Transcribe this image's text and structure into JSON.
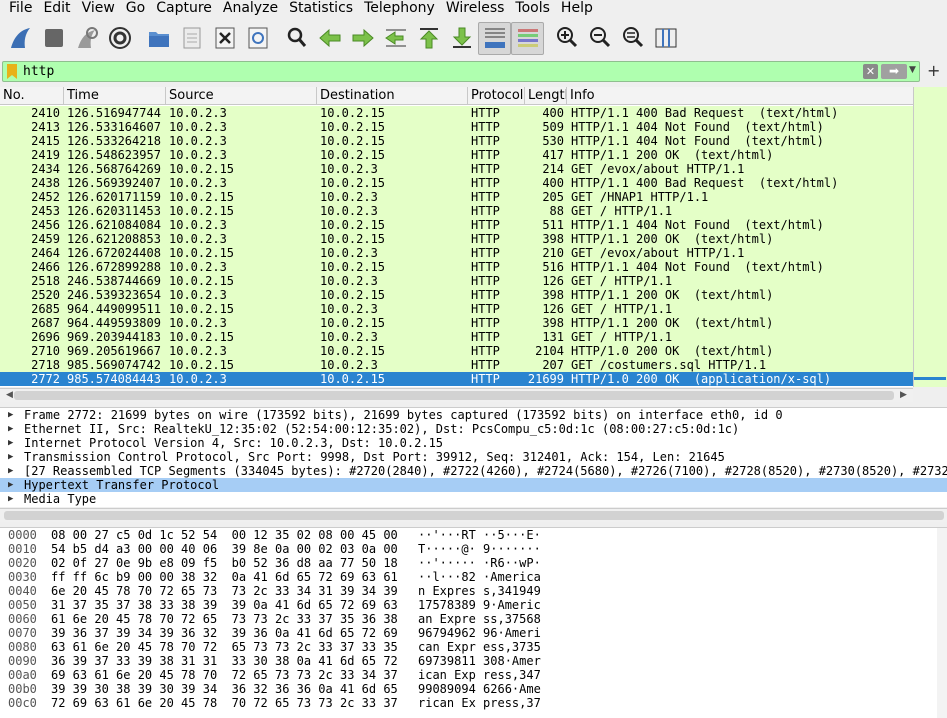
{
  "menu": [
    "File",
    "Edit",
    "View",
    "Go",
    "Capture",
    "Analyze",
    "Statistics",
    "Telephony",
    "Wireless",
    "Tools",
    "Help"
  ],
  "toolbar": {
    "icons": [
      "shark-fin-start-icon",
      "stop-capture-icon",
      "restart-capture-icon",
      "capture-options-icon",
      "open-file-icon",
      "save-file-icon",
      "close-file-icon",
      "reload-file-icon",
      "find-packet-icon",
      "go-back-icon",
      "go-forward-icon",
      "go-to-packet-icon",
      "go-first-icon",
      "go-last-icon",
      "autoscroll-icon",
      "colorize-icon",
      "zoom-in-icon",
      "zoom-out-icon",
      "zoom-reset-icon",
      "resize-columns-icon"
    ]
  },
  "filter": {
    "value": "http",
    "plus": "+"
  },
  "columns": {
    "no": "No.",
    "time": "Time",
    "source": "Source",
    "destination": "Destination",
    "protocol": "Protocol",
    "length": "Length",
    "info": "Info"
  },
  "packets": [
    {
      "no": "2410",
      "time": "126.516947744",
      "src": "10.0.2.3",
      "dst": "10.0.2.15",
      "proto": "HTTP",
      "len": "400",
      "info": "HTTP/1.1 400 Bad Request  (text/html)"
    },
    {
      "no": "2413",
      "time": "126.533164607",
      "src": "10.0.2.3",
      "dst": "10.0.2.15",
      "proto": "HTTP",
      "len": "509",
      "info": "HTTP/1.1 404 Not Found  (text/html)"
    },
    {
      "no": "2415",
      "time": "126.533264218",
      "src": "10.0.2.3",
      "dst": "10.0.2.15",
      "proto": "HTTP",
      "len": "530",
      "info": "HTTP/1.1 404 Not Found  (text/html)"
    },
    {
      "no": "2419",
      "time": "126.548623957",
      "src": "10.0.2.3",
      "dst": "10.0.2.15",
      "proto": "HTTP",
      "len": "417",
      "info": "HTTP/1.1 200 OK  (text/html)"
    },
    {
      "no": "2434",
      "time": "126.568764269",
      "src": "10.0.2.15",
      "dst": "10.0.2.3",
      "proto": "HTTP",
      "len": "214",
      "info": "GET /evox/about HTTP/1.1"
    },
    {
      "no": "2438",
      "time": "126.569392407",
      "src": "10.0.2.3",
      "dst": "10.0.2.15",
      "proto": "HTTP",
      "len": "400",
      "info": "HTTP/1.1 400 Bad Request  (text/html)"
    },
    {
      "no": "2452",
      "time": "126.620171159",
      "src": "10.0.2.15",
      "dst": "10.0.2.3",
      "proto": "HTTP",
      "len": "205",
      "info": "GET /HNAP1 HTTP/1.1"
    },
    {
      "no": "2453",
      "time": "126.620311453",
      "src": "10.0.2.15",
      "dst": "10.0.2.3",
      "proto": "HTTP",
      "len": "88",
      "info": "GET / HTTP/1.1"
    },
    {
      "no": "2456",
      "time": "126.621084084",
      "src": "10.0.2.3",
      "dst": "10.0.2.15",
      "proto": "HTTP",
      "len": "511",
      "info": "HTTP/1.1 404 Not Found  (text/html)"
    },
    {
      "no": "2459",
      "time": "126.621208853",
      "src": "10.0.2.3",
      "dst": "10.0.2.15",
      "proto": "HTTP",
      "len": "398",
      "info": "HTTP/1.1 200 OK  (text/html)"
    },
    {
      "no": "2464",
      "time": "126.672024408",
      "src": "10.0.2.15",
      "dst": "10.0.2.3",
      "proto": "HTTP",
      "len": "210",
      "info": "GET /evox/about HTTP/1.1"
    },
    {
      "no": "2466",
      "time": "126.672899288",
      "src": "10.0.2.3",
      "dst": "10.0.2.15",
      "proto": "HTTP",
      "len": "516",
      "info": "HTTP/1.1 404 Not Found  (text/html)"
    },
    {
      "no": "2518",
      "time": "246.538744669",
      "src": "10.0.2.15",
      "dst": "10.0.2.3",
      "proto": "HTTP",
      "len": "126",
      "info": "GET / HTTP/1.1"
    },
    {
      "no": "2520",
      "time": "246.539323654",
      "src": "10.0.2.3",
      "dst": "10.0.2.15",
      "proto": "HTTP",
      "len": "398",
      "info": "HTTP/1.1 200 OK  (text/html)"
    },
    {
      "no": "2685",
      "time": "964.449099511",
      "src": "10.0.2.15",
      "dst": "10.0.2.3",
      "proto": "HTTP",
      "len": "126",
      "info": "GET / HTTP/1.1"
    },
    {
      "no": "2687",
      "time": "964.449593809",
      "src": "10.0.2.3",
      "dst": "10.0.2.15",
      "proto": "HTTP",
      "len": "398",
      "info": "HTTP/1.1 200 OK  (text/html)"
    },
    {
      "no": "2696",
      "time": "969.203944183",
      "src": "10.0.2.15",
      "dst": "10.0.2.3",
      "proto": "HTTP",
      "len": "131",
      "info": "GET / HTTP/1.1"
    },
    {
      "no": "2710",
      "time": "969.205619667",
      "src": "10.0.2.3",
      "dst": "10.0.2.15",
      "proto": "HTTP",
      "len": "2104",
      "info": "HTTP/1.0 200 OK  (text/html)"
    },
    {
      "no": "2718",
      "time": "985.569074742",
      "src": "10.0.2.15",
      "dst": "10.0.2.3",
      "proto": "HTTP",
      "len": "207",
      "info": "GET /costumers.sql HTTP/1.1"
    },
    {
      "no": "2772",
      "time": "985.574084443",
      "src": "10.0.2.3",
      "dst": "10.0.2.15",
      "proto": "HTTP",
      "len": "21699",
      "info": "HTTP/1.0 200 OK  (application/x-sql)"
    }
  ],
  "selected_packet_index": 19,
  "details": [
    "Frame 2772: 21699 bytes on wire (173592 bits), 21699 bytes captured (173592 bits) on interface eth0, id 0",
    "Ethernet II, Src: RealtekU_12:35:02 (52:54:00:12:35:02), Dst: PcsCompu_c5:0d:1c (08:00:27:c5:0d:1c)",
    "Internet Protocol Version 4, Src: 10.0.2.3, Dst: 10.0.2.15",
    "Transmission Control Protocol, Src Port: 9998, Dst Port: 39912, Seq: 312401, Ack: 154, Len: 21645",
    "[27 Reassembled TCP Segments (334045 bytes): #2720(2840), #2722(4260), #2724(5680), #2726(7100), #2728(8520), #2730(8520), #2732(",
    "Hypertext Transfer Protocol",
    "Media Type"
  ],
  "selected_detail_index": 5,
  "bytes": [
    {
      "off": "0000",
      "hex": "08 00 27 c5 0d 1c 52 54  00 12 35 02 08 00 45 00",
      "asc": "··'···RT ··5···E·"
    },
    {
      "off": "0010",
      "hex": "54 b5 d4 a3 00 00 40 06  39 8e 0a 00 02 03 0a 00",
      "asc": "T·····@· 9·······"
    },
    {
      "off": "0020",
      "hex": "02 0f 27 0e 9b e8 09 f5  b0 52 36 d8 aa 77 50 18",
      "asc": "··'····· ·R6··wP·"
    },
    {
      "off": "0030",
      "hex": "ff ff 6c b9 00 00 38 32  0a 41 6d 65 72 69 63 61",
      "asc": "··l···82 ·America"
    },
    {
      "off": "0040",
      "hex": "6e 20 45 78 70 72 65 73  73 2c 33 34 31 39 34 39",
      "asc": "n Expres s,341949"
    },
    {
      "off": "0050",
      "hex": "31 37 35 37 38 33 38 39  39 0a 41 6d 65 72 69 63",
      "asc": "17578389 9·Americ"
    },
    {
      "off": "0060",
      "hex": "61 6e 20 45 78 70 72 65  73 73 2c 33 37 35 36 38",
      "asc": "an Expre ss,37568"
    },
    {
      "off": "0070",
      "hex": "39 36 37 39 34 39 36 32  39 36 0a 41 6d 65 72 69",
      "asc": "96794962 96·Ameri"
    },
    {
      "off": "0080",
      "hex": "63 61 6e 20 45 78 70 72  65 73 73 2c 33 37 33 35",
      "asc": "can Expr ess,3735"
    },
    {
      "off": "0090",
      "hex": "36 39 37 33 39 38 31 31  33 30 38 0a 41 6d 65 72",
      "asc": "69739811 308·Amer"
    },
    {
      "off": "00a0",
      "hex": "69 63 61 6e 20 45 78 70  72 65 73 73 2c 33 34 37",
      "asc": "ican Exp ress,347"
    },
    {
      "off": "00b0",
      "hex": "39 39 30 38 39 30 39 34  36 32 36 36 0a 41 6d 65",
      "asc": "99089094 6266·Ame"
    },
    {
      "off": "00c0",
      "hex": "72 69 63 61 6e 20 45 78  70 72 65 73 73 2c 33 37",
      "asc": "rican Ex press,37"
    }
  ],
  "colors": {
    "row_bg": "#e4ffc7",
    "selected": "#2a84d0",
    "filter_ok": "#afffaf"
  }
}
